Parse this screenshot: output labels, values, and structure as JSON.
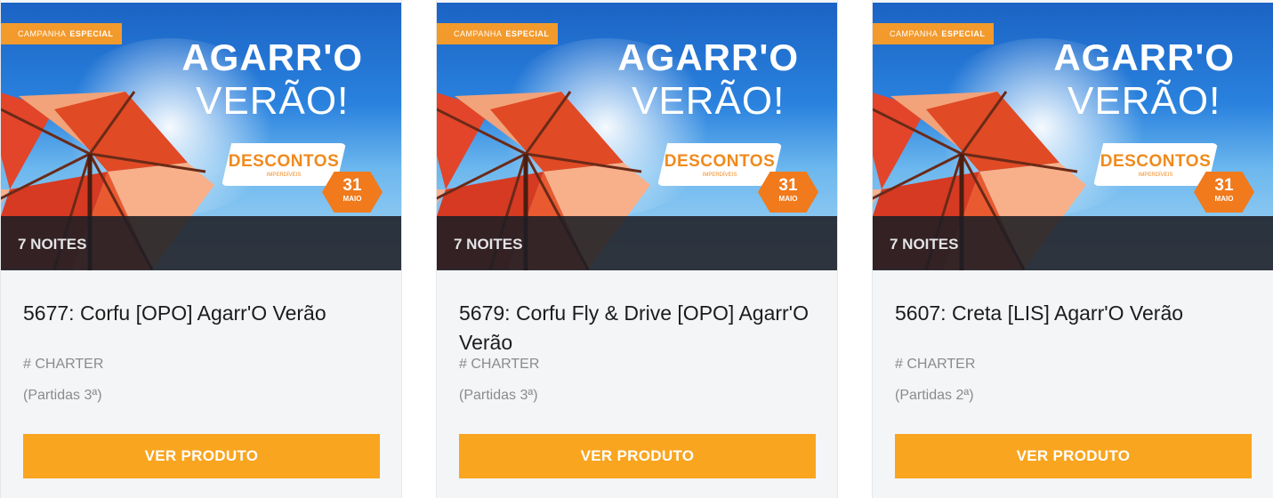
{
  "banner": {
    "campaign_prefix": "CAMPANHA",
    "campaign_highlight": "ESPECIAL",
    "headline_line1": "AGARR'O",
    "headline_line2": "VERÃO!",
    "discount_label": "DESCONTOS",
    "discount_sub": "IMPERDÍVEIS",
    "date_day": "31",
    "date_month": "MAIO"
  },
  "colors": {
    "accent_orange": "#f9a51f",
    "tag_orange": "#f39a2c",
    "sky_blue": "#2a82de"
  },
  "products": [
    {
      "nights": "7 NOITES",
      "title": "5677: Corfu [OPO] Agarr'O Verão",
      "tag": "# CHARTER",
      "departures": "(Partidas 3ª)",
      "cta": "VER PRODUTO"
    },
    {
      "nights": "7 NOITES",
      "title": "5679: Corfu Fly & Drive [OPO] Agarr'O Verão",
      "tag": "# CHARTER",
      "departures": "(Partidas 3ª)",
      "cta": "VER PRODUTO"
    },
    {
      "nights": "7 NOITES",
      "title": "5607: Creta [LIS] Agarr'O Verão",
      "tag": "# CHARTER",
      "departures": "(Partidas 2ª)",
      "cta": "VER PRODUTO"
    }
  ]
}
